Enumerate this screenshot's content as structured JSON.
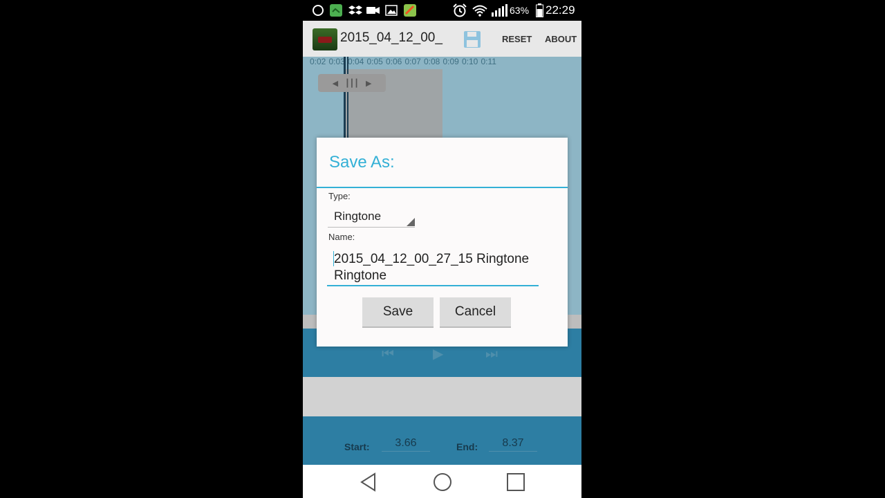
{
  "status_bar": {
    "battery": "63%",
    "time": "22:29"
  },
  "action_bar": {
    "file_title": "2015_04_12_00_",
    "reset_label": "RESET",
    "about_label": "ABOUT"
  },
  "timeline": {
    "ticks": [
      "0:02",
      "0:03",
      "0:04",
      "0:05",
      "0:06",
      "0:07",
      "0:08",
      "0:09",
      "0:10",
      "0:11"
    ]
  },
  "bottom_info": {
    "start_label": "Start:",
    "start_value": "3.66",
    "end_label": "End:",
    "end_value": "8.37"
  },
  "dialog": {
    "title": "Save As:",
    "type_label": "Type:",
    "type_value": "Ringtone",
    "name_label": "Name:",
    "name_value": "2015_04_12_00_27_15 Ringtone Ringtone",
    "save_label": "Save",
    "cancel_label": "Cancel"
  },
  "colors": {
    "accent": "#33b0d6",
    "controls_bg": "#2d7ea3"
  }
}
